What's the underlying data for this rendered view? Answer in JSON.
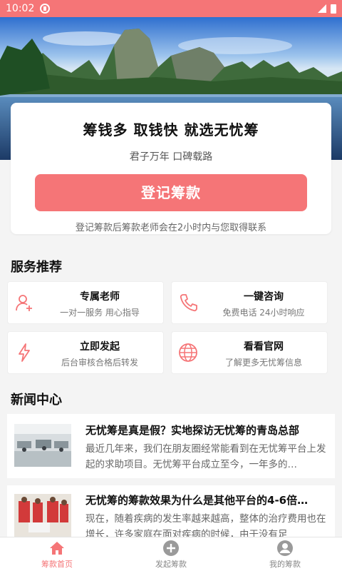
{
  "status_bar": {
    "time": "10:02"
  },
  "promo": {
    "title": "筹钱多 取钱快 就选无忧筹",
    "subtitle": "君子万年 口碑载路",
    "cta_label": "登记筹款",
    "note": "登记筹款后筹款老师会在2小时内与您取得联系"
  },
  "services": {
    "title": "服务推荐",
    "items": [
      {
        "title": "专属老师",
        "desc": "一对一服务 用心指导",
        "icon": "user-plus-icon"
      },
      {
        "title": "一键咨询",
        "desc": "免费电话 24小时响应",
        "icon": "phone-icon"
      },
      {
        "title": "立即发起",
        "desc": "后台审核合格后转发",
        "icon": "lightning-icon"
      },
      {
        "title": "看看官网",
        "desc": "了解更多无忧筹信息",
        "icon": "globe-icon"
      }
    ]
  },
  "news": {
    "title": "新闻中心",
    "items": [
      {
        "title": "无忧筹是真是假？实地探访无忧筹的青岛总部",
        "excerpt": "最近几年来，我们在朋友圈经常能看到在无忧筹平台上发起的求助项目。无忧筹平台成立至今，一年多的…"
      },
      {
        "title": "无忧筹的筹款效果为什么是其他平台的4-6倍…",
        "excerpt": "现在，随着疾病的发生率越来越高，整体的治疗费用也在增长，许多家庭在面对疾病的时候，由于没有足"
      }
    ]
  },
  "nav": {
    "tabs": [
      {
        "label": "筹款首页",
        "icon": "home-icon",
        "active": true
      },
      {
        "label": "发起筹款",
        "icon": "plus-circle-icon",
        "active": false
      },
      {
        "label": "我的筹款",
        "icon": "user-circle-icon",
        "active": false
      }
    ]
  },
  "colors": {
    "accent": "#f57577"
  }
}
